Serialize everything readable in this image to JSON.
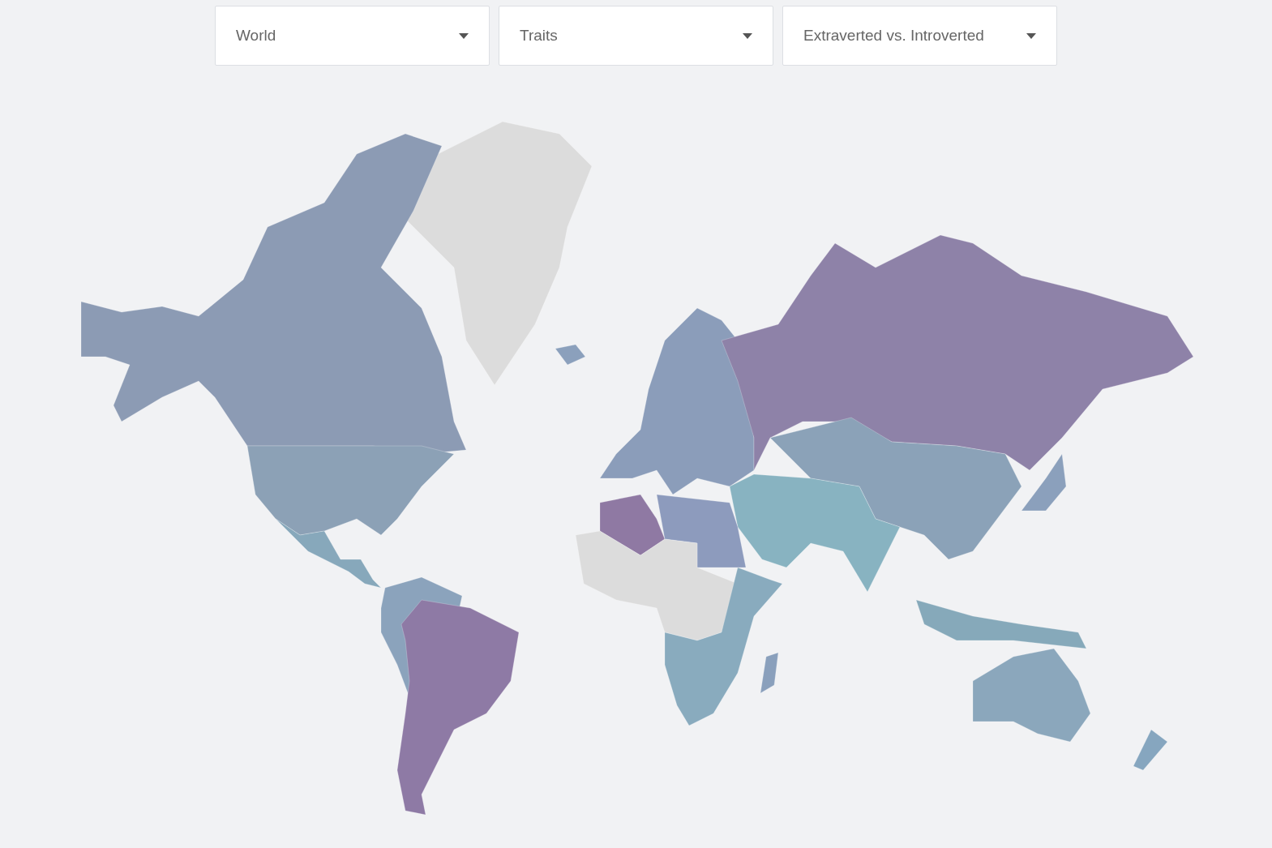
{
  "filters": [
    {
      "value": "World"
    },
    {
      "value": "Traits"
    },
    {
      "value": "Extraverted vs. Introverted"
    }
  ]
}
